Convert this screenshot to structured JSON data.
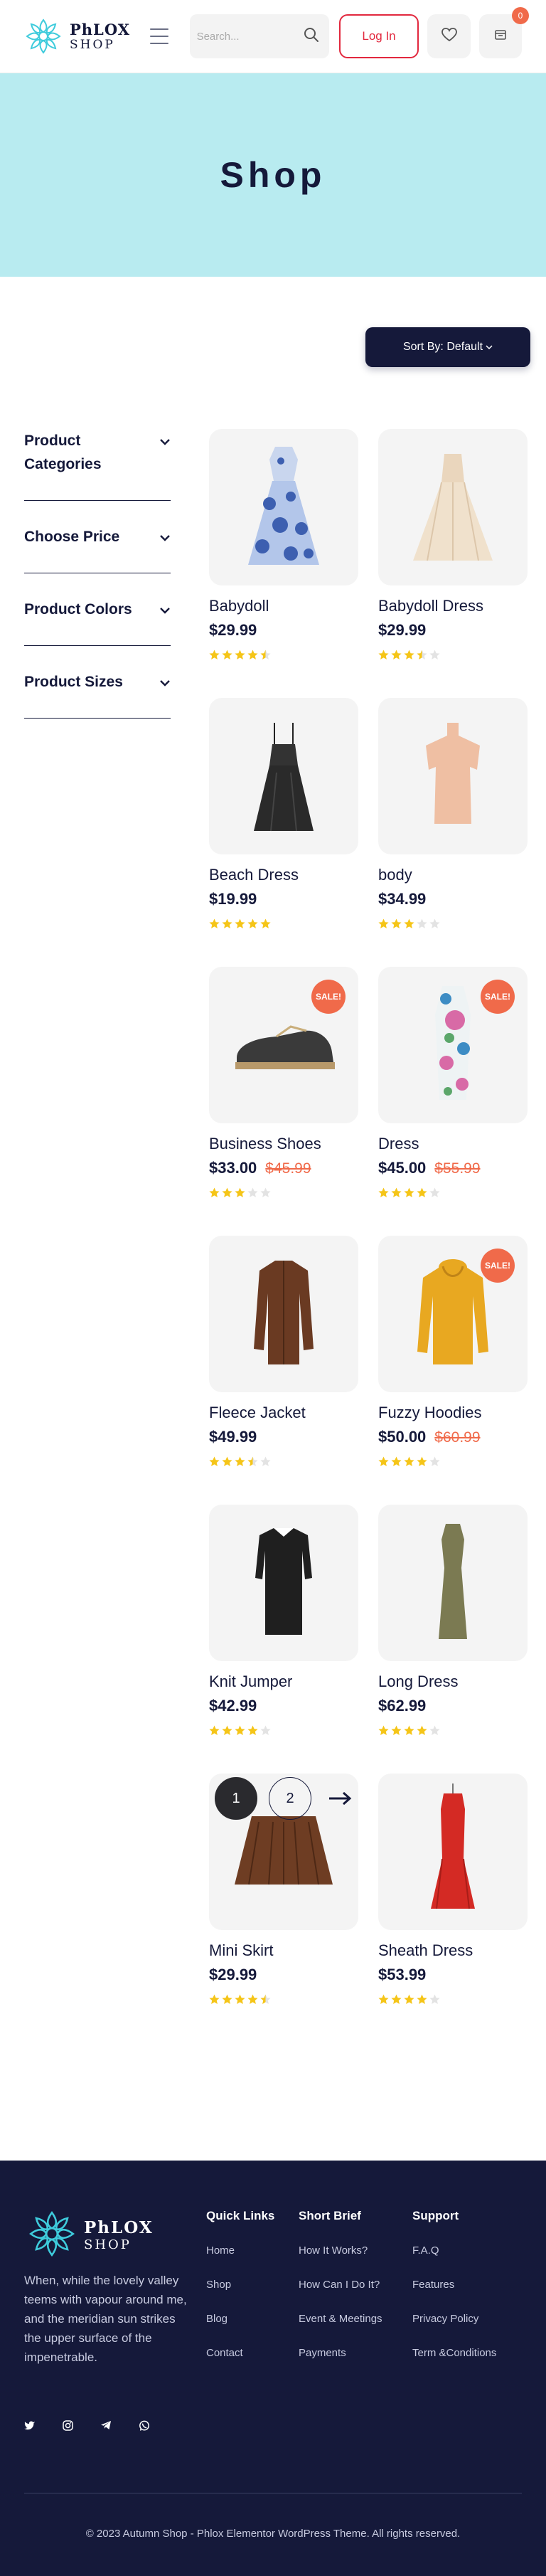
{
  "header": {
    "logo_line1": "PhLOX",
    "logo_line2": "SHOP",
    "search_placeholder": "Search...",
    "login_label": "Log In",
    "cart_count": "0"
  },
  "hero": {
    "title": "Shop"
  },
  "sort": {
    "label": "Sort By: Default"
  },
  "filters": [
    {
      "label": "Product Categories"
    },
    {
      "label": "Choose Price"
    },
    {
      "label": "Product Colors"
    },
    {
      "label": "Product Sizes"
    }
  ],
  "products": [
    {
      "name": "Babydoll",
      "price": "$29.99",
      "old_price": "",
      "sale": "",
      "rating": 4.5
    },
    {
      "name": "Babydoll Dress",
      "price": "$29.99",
      "old_price": "",
      "sale": "",
      "rating": 3.5
    },
    {
      "name": "Beach Dress",
      "price": "$19.99",
      "old_price": "",
      "sale": "",
      "rating": 5
    },
    {
      "name": "body",
      "price": "$34.99",
      "old_price": "",
      "sale": "",
      "rating": 3
    },
    {
      "name": "Business Shoes",
      "price": "$33.00",
      "old_price": "$45.99",
      "sale": "SALE!",
      "rating": 3
    },
    {
      "name": "Dress",
      "price": "$45.00",
      "old_price": "$55.99",
      "sale": "SALE!",
      "rating": 4
    },
    {
      "name": "Fleece Jacket",
      "price": "$49.99",
      "old_price": "",
      "sale": "",
      "rating": 3.5
    },
    {
      "name": "Fuzzy Hoodies",
      "price": "$50.00",
      "old_price": "$60.99",
      "sale": "SALE!",
      "rating": 4
    },
    {
      "name": "Knit Jumper",
      "price": "$42.99",
      "old_price": "",
      "sale": "",
      "rating": 4
    },
    {
      "name": "Long Dress",
      "price": "$62.99",
      "old_price": "",
      "sale": "",
      "rating": 4
    },
    {
      "name": "Mini Skirt",
      "price": "$29.99",
      "old_price": "",
      "sale": "",
      "rating": 4.5
    },
    {
      "name": "Sheath Dress",
      "price": "$53.99",
      "old_price": "",
      "sale": "",
      "rating": 4
    }
  ],
  "pagination": {
    "pages": [
      "1",
      "2"
    ],
    "current": "1"
  },
  "footer": {
    "logo_line1": "PhLOX",
    "logo_line2": "SHOP",
    "about": "When, while the lovely valley teems with vapour around me, and the meridian sun strikes the upper surface of the impenetrable.",
    "socials": [
      "twitter-icon",
      "instagram-icon",
      "telegram-icon",
      "whatsapp-icon"
    ],
    "quick_links": {
      "title": "Quick Links",
      "items": [
        "Home",
        "Shop",
        "Blog",
        "Contact"
      ]
    },
    "short_brief": {
      "title": "Short Brief",
      "items": [
        "How It Works?",
        "How Can I Do It?",
        "Event & Meetings",
        "Payments"
      ]
    },
    "support": {
      "title": "Support",
      "items": [
        "F.A.Q",
        "Features",
        "Privacy Policy",
        "Term &Conditions"
      ]
    },
    "copyright": "© 2023 Autumn Shop - Phlox Elementor WordPress Theme. All rights reserved."
  },
  "colors": {
    "navy": "#15193a",
    "cyan": "#b8ebf0",
    "red": "#e2283e",
    "sale": "#f06a4a",
    "star": "#f5c518"
  }
}
